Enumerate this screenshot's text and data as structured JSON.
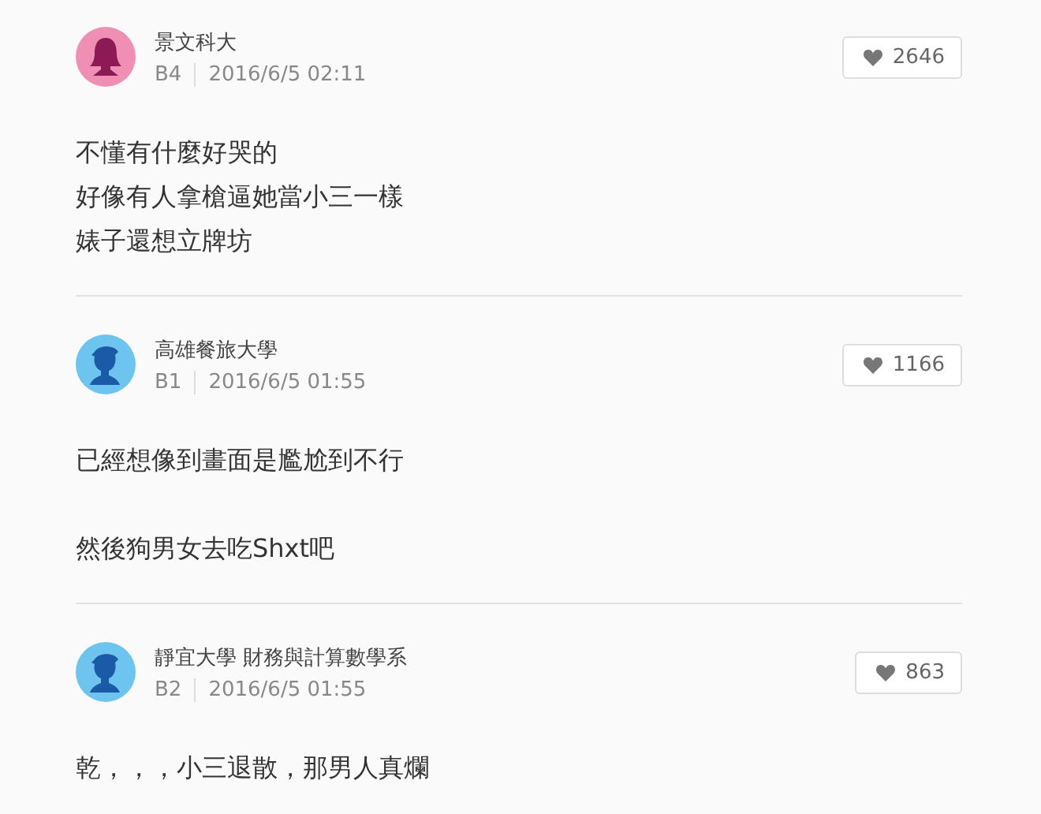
{
  "comments": [
    {
      "kind": "female",
      "author": "景文科大",
      "floor": "B4",
      "time": "2016/6/5 02:11",
      "likes": "2646",
      "paragraphs": [
        [
          "不懂有什麼好哭的",
          "好像有人拿槍逼她當小三一樣",
          "婊子還想立牌坊"
        ]
      ]
    },
    {
      "kind": "male",
      "author": "高雄餐旅大學",
      "floor": "B1",
      "time": "2016/6/5 01:55",
      "likes": "1166",
      "paragraphs": [
        [
          "已經想像到畫面是尷尬到不行"
        ],
        [
          "然後狗男女去吃Shxt吧"
        ]
      ]
    },
    {
      "kind": "male",
      "author": "靜宜大學 財務與計算數學系",
      "floor": "B2",
      "time": "2016/6/5 01:55",
      "likes": "863",
      "paragraphs": [
        [
          "乾，，，小三退散，那男人真爛"
        ]
      ]
    }
  ]
}
